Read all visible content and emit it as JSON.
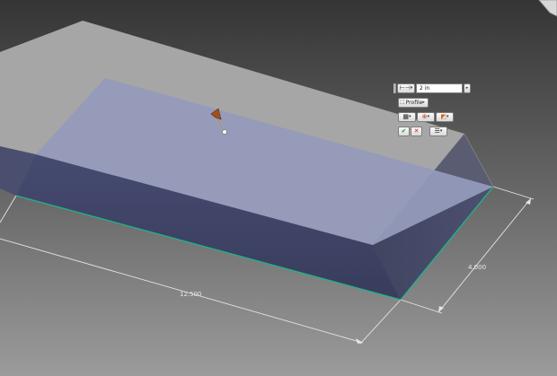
{
  "viewport": {
    "dimension_length": "12.500",
    "dimension_width": "4.000"
  },
  "mini_toolbar": {
    "distance_value": "2 in",
    "profile_label": "Profile",
    "ok_glyph": "✔",
    "cancel_glyph": "✕",
    "dropdown_glyph": "▾",
    "icons": [
      "extents-icon",
      "profile-select-icon",
      "direction-icon",
      "operation-icon",
      "output-icon",
      "ok-icon",
      "cancel-icon",
      "options-menu-icon"
    ]
  },
  "colors": {
    "background_top": "#353535",
    "background_bottom": "#9a9a9a",
    "block_top": "#a5a5a5",
    "profile_fill": "#939ab8",
    "front_face": "#3f4468",
    "edge_highlight": "#1fb48a",
    "arrow_orange": "#a04e1c",
    "ok_green": "#1c9a2c",
    "cancel_red": "#d21e1e"
  }
}
